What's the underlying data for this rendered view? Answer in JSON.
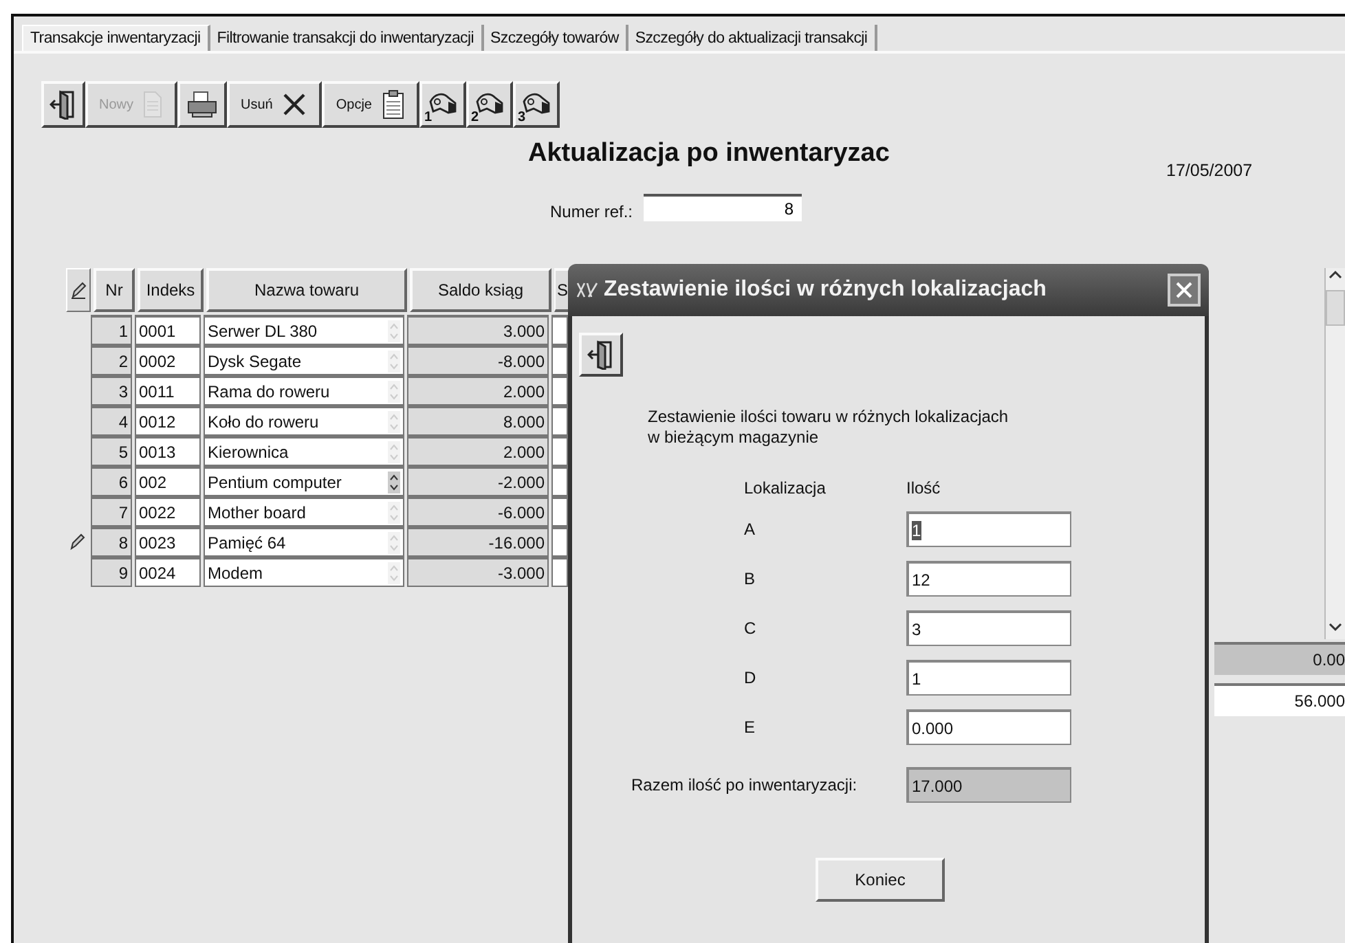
{
  "tabs": [
    {
      "label": "Transakcje inwentaryzacji",
      "selected": true
    },
    {
      "label": "Filtrowanie transakcji do inwentaryzacji",
      "selected": false
    },
    {
      "label": "Szczegóły towarów",
      "selected": false
    },
    {
      "label": "Szczegóły do aktualizacji transakcji",
      "selected": false
    }
  ],
  "toolbar": [
    {
      "kind": "exit",
      "disabled": false
    },
    {
      "kind": "new",
      "label": "Nowy",
      "disabled": true
    },
    {
      "kind": "print",
      "disabled": false
    },
    {
      "kind": "delete",
      "label": "Usuń",
      "disabled": false
    },
    {
      "kind": "options",
      "label": "Opcje",
      "disabled": false
    },
    {
      "kind": "hand",
      "number": "1",
      "disabled": false
    },
    {
      "kind": "hand",
      "number": "2",
      "disabled": false
    },
    {
      "kind": "hand",
      "number": "3",
      "disabled": false
    }
  ],
  "title": "Aktualizacja po inwentaryzac",
  "date": "17/05/2007",
  "ref": {
    "label": "Numer ref.:",
    "value": "8"
  },
  "table": {
    "columns": [
      "Nr",
      "Indeks",
      "Nazwa towaru",
      "Saldo ksiąg",
      "S"
    ],
    "rows": [
      {
        "nr": "1",
        "index": "0001",
        "name": "Serwer DL 380",
        "balance": "3.000",
        "editing": false,
        "spinner_active": false
      },
      {
        "nr": "2",
        "index": "0002",
        "name": "Dysk Segate",
        "balance": "-8.000",
        "editing": false,
        "spinner_active": false
      },
      {
        "nr": "3",
        "index": "0011",
        "name": "Rama do roweru",
        "balance": "2.000",
        "editing": false,
        "spinner_active": false
      },
      {
        "nr": "4",
        "index": "0012",
        "name": "Koło do roweru",
        "balance": "8.000",
        "editing": false,
        "spinner_active": false
      },
      {
        "nr": "5",
        "index": "0013",
        "name": "Kierownica",
        "balance": "2.000",
        "editing": false,
        "spinner_active": false
      },
      {
        "nr": "6",
        "index": "002",
        "name": "Pentium computer",
        "balance": "-2.000",
        "editing": false,
        "spinner_active": true
      },
      {
        "nr": "7",
        "index": "0022",
        "name": "Mother board",
        "balance": "-6.000",
        "editing": false,
        "spinner_active": false
      },
      {
        "nr": "8",
        "index": "0023",
        "name": "Pamięć 64",
        "balance": "-16.000",
        "editing": true,
        "spinner_active": false
      },
      {
        "nr": "9",
        "index": "0024",
        "name": "Modem",
        "balance": "-3.000",
        "editing": false,
        "spinner_active": false
      }
    ]
  },
  "right_fields": [
    {
      "value": "0.00",
      "disabled": true
    },
    {
      "value": "56.000",
      "disabled": false
    }
  ],
  "dialog": {
    "title": "Zestawienie ilości w różnych lokalizacjach",
    "description": "Zestawienie ilości towaru w różnych lokalizacjach\nw bieżącym magazynie",
    "location_header": "Lokalizacja",
    "quantity_header": "Ilość",
    "locations": [
      {
        "label": "A",
        "value": "1",
        "focused": true
      },
      {
        "label": "B",
        "value": "12",
        "focused": false
      },
      {
        "label": "C",
        "value": "3",
        "focused": false
      },
      {
        "label": "D",
        "value": "1",
        "focused": false
      },
      {
        "label": "E",
        "value": "0.000",
        "focused": false
      }
    ],
    "total": {
      "label": "Razem ilość po inwentaryzacji:",
      "value": "17.000"
    },
    "button": "Koniec"
  }
}
